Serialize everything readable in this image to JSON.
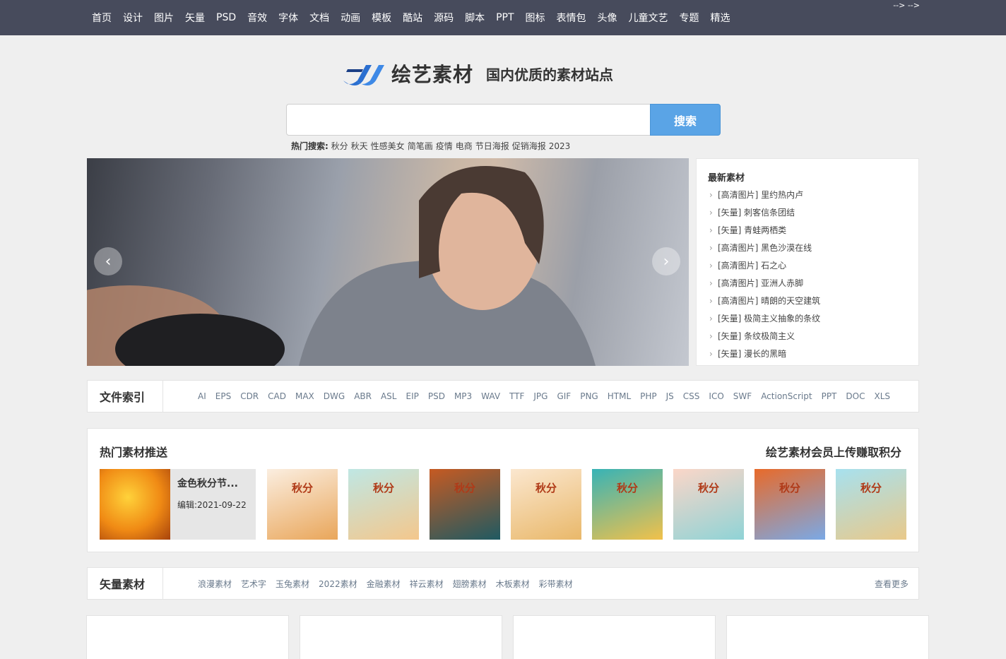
{
  "nav": {
    "items": [
      "首页",
      "设计",
      "图片",
      "矢量",
      "PSD",
      "音效",
      "字体",
      "文档",
      "动画",
      "模板",
      "酷站",
      "源码",
      "脚本",
      "PPT",
      "图标",
      "表情包",
      "头像",
      "儿童文艺",
      "专题",
      "精选"
    ],
    "stray": "--> -->"
  },
  "brand": {
    "name": "绘艺素材",
    "slogan": "国内优质的素材站点"
  },
  "search": {
    "value": "",
    "placeholder": "",
    "button": "搜索"
  },
  "hot_search": {
    "label": "热门搜索:",
    "keywords": [
      "秋分",
      "秋天",
      "性感美女",
      "简笔画",
      "疫情",
      "电商",
      "节日海报",
      "促销海报",
      "2023"
    ]
  },
  "banner": {
    "prev_icon": "‹",
    "next_icon": "›"
  },
  "latest": {
    "title": "最新素材",
    "items": [
      "[高清图片] 里约热内卢",
      "[矢量] 刺客信条团结",
      "[矢量] 青蛙两栖类",
      "[高清图片] 黑色沙漠在线",
      "[高清图片] 石之心",
      "[高清图片] 亚洲人赤脚",
      "[高清图片] 晴朗的天空建筑",
      "[矢量] 极简主义抽象的条纹",
      "[矢量] 条纹极简主义",
      "[矢量] 漫长的黑暗"
    ]
  },
  "file_index": {
    "title": "文件索引",
    "tags": [
      "AI",
      "EPS",
      "CDR",
      "CAD",
      "MAX",
      "DWG",
      "ABR",
      "ASL",
      "EIP",
      "PSD",
      "MP3",
      "WAV",
      "TTF",
      "JPG",
      "GIF",
      "PNG",
      "HTML",
      "PHP",
      "JS",
      "CSS",
      "ICO",
      "SWF",
      "ActionScript",
      "PPT",
      "DOC",
      "XLS"
    ]
  },
  "hot_picks": {
    "title": "热门素材推送",
    "link": "绘艺素材会员上传赚取积分",
    "feature": {
      "title": "金色秋分节...",
      "date": "编辑:2021-09-22"
    },
    "thumbs": [
      {
        "mark": "秋分",
        "colors": [
          "#fbeee0",
          "#e9a65a"
        ]
      },
      {
        "mark": "秋分",
        "colors": [
          "#bfe7e4",
          "#f4c78c"
        ]
      },
      {
        "mark": "秋分",
        "colors": [
          "#c65a22",
          "#1f5a62"
        ]
      },
      {
        "mark": "秋分",
        "colors": [
          "#fbe7cf",
          "#e9b86a"
        ]
      },
      {
        "mark": "秋分",
        "colors": [
          "#37b3b6",
          "#f2c14a"
        ]
      },
      {
        "mark": "秋分",
        "colors": [
          "#fbd6c8",
          "#8fd3d6"
        ]
      },
      {
        "mark": "秋分",
        "colors": [
          "#e86a2a",
          "#7aa9e6"
        ]
      },
      {
        "mark": "秋分",
        "colors": [
          "#a7e1ef",
          "#e9c98a"
        ]
      }
    ]
  },
  "vector": {
    "title": "矢量素材",
    "tags": [
      "浪漫素材",
      "艺术字",
      "玉兔素材",
      "2022素材",
      "金融素材",
      "祥云素材",
      "翅膀素材",
      "木板素材",
      "彩带素材"
    ],
    "more": "查看更多"
  },
  "colors": {
    "nav_bg": "#474b5c",
    "accent": "#5aa4e6",
    "page_bg": "#efefef"
  }
}
